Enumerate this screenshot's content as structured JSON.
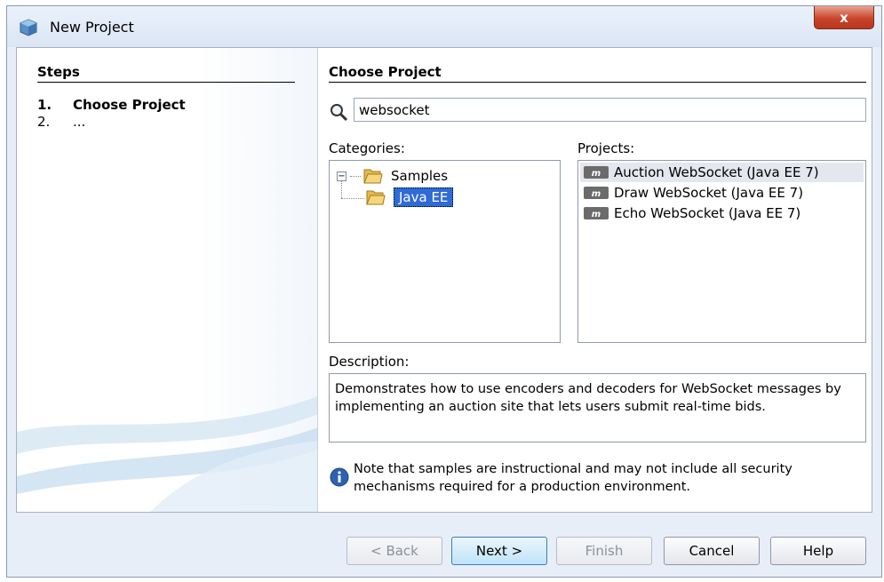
{
  "window": {
    "title": "New Project",
    "close_label": "x"
  },
  "steps": {
    "header": "Steps",
    "items": [
      {
        "num": "1.",
        "label": "Choose Project"
      },
      {
        "num": "2.",
        "label": "..."
      }
    ]
  },
  "main": {
    "header": "Choose Project",
    "search": {
      "value": "websocket"
    },
    "categories": {
      "label": "Categories:",
      "tree": [
        {
          "label": "Samples",
          "expander": "−"
        },
        {
          "label": "Java EE"
        }
      ]
    },
    "projects": {
      "label": "Projects:",
      "items": [
        {
          "label": "Auction WebSocket (Java EE 7)"
        },
        {
          "label": "Draw WebSocket (Java EE 7)"
        },
        {
          "label": "Echo WebSocket (Java EE 7)"
        }
      ]
    },
    "description": {
      "label": "Description:",
      "text": "Demonstrates how to use encoders and decoders for WebSocket messages by implementing an auction site that lets users submit real-time bids."
    },
    "note": "Note that samples are instructional and may not include all security mechanisms required for a production environment."
  },
  "buttons": {
    "back": "< Back",
    "next": "Next >",
    "finish": "Finish",
    "cancel": "Cancel",
    "help": "Help"
  },
  "colors": {
    "selection": "#2f6bd6",
    "close": "#c8452c",
    "primary_button": "#bfe3f8"
  },
  "icons": {
    "title": "netbeans-cube-icon",
    "search": "magnifier-icon",
    "folder": "folder-icon",
    "project": "maven-project-icon",
    "info": "info-icon"
  }
}
